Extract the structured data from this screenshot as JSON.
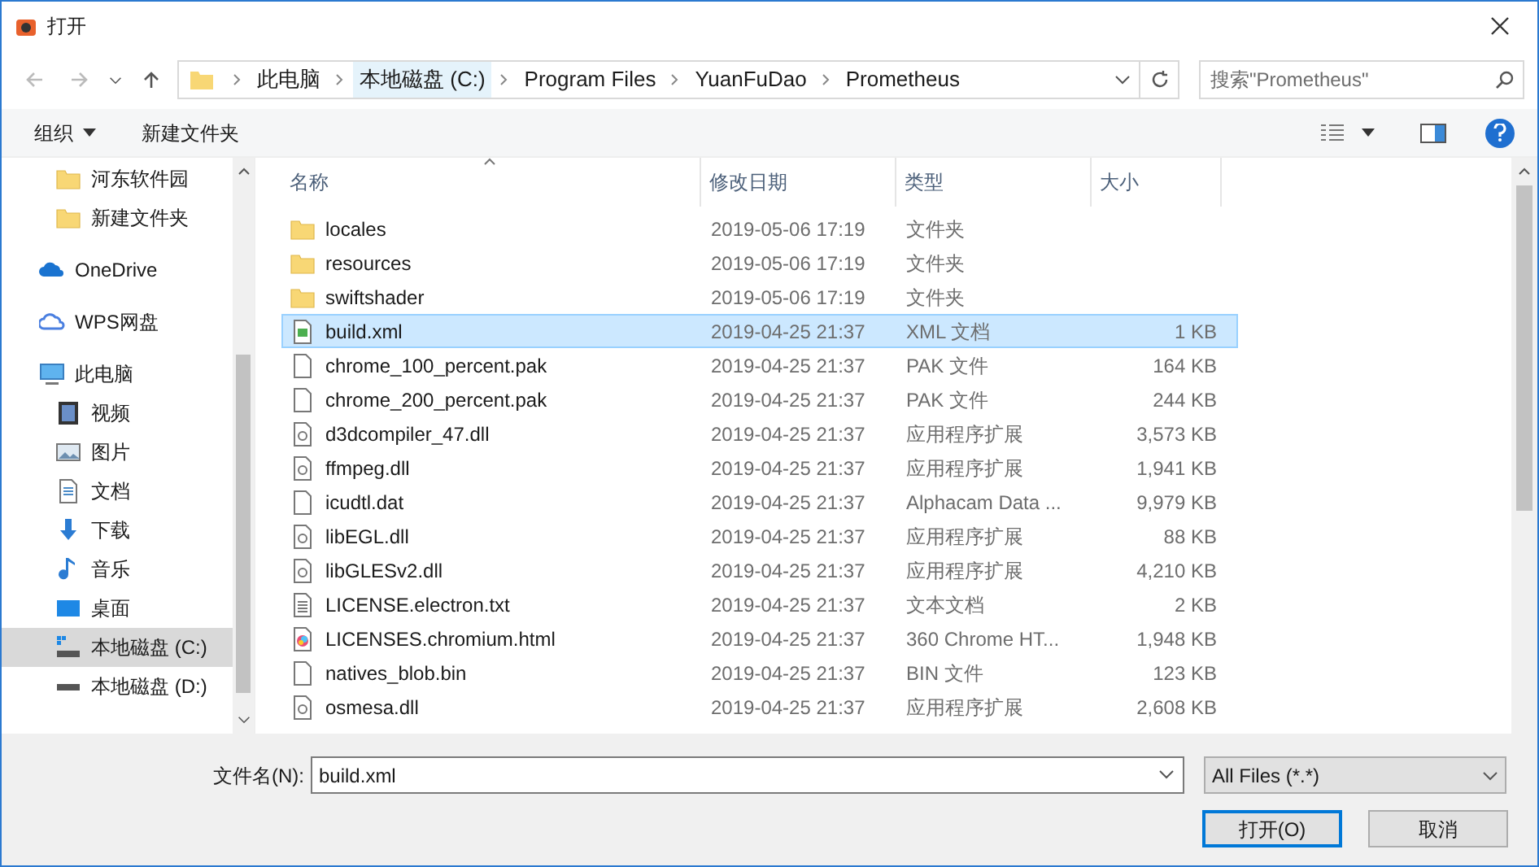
{
  "window": {
    "title": "打开"
  },
  "address": {
    "crumbs": [
      {
        "label": "此电脑",
        "selected": false
      },
      {
        "label": "本地磁盘 (C:)",
        "selected": true
      },
      {
        "label": "Program Files",
        "selected": false
      },
      {
        "label": "YuanFuDao",
        "selected": false
      },
      {
        "label": "Prometheus",
        "selected": false
      }
    ]
  },
  "search": {
    "placeholder": "搜索\"Prometheus\""
  },
  "toolbar": {
    "organize": "组织",
    "new_folder": "新建文件夹"
  },
  "sidebar": {
    "quick_access": [
      {
        "label": "河东软件园",
        "kind": "folder",
        "selected": false
      },
      {
        "label": "新建文件夹",
        "kind": "folder",
        "selected": false
      }
    ],
    "items": [
      {
        "label": "OneDrive",
        "kind": "cloud",
        "selected": false
      },
      {
        "label": "WPS网盘",
        "kind": "cloud-outline",
        "selected": false
      },
      {
        "label": "此电脑",
        "kind": "pc",
        "selected": false,
        "children": [
          {
            "label": "视频",
            "kind": "video",
            "selected": false
          },
          {
            "label": "图片",
            "kind": "picture",
            "selected": false
          },
          {
            "label": "文档",
            "kind": "doc",
            "selected": false
          },
          {
            "label": "下载",
            "kind": "download",
            "selected": false
          },
          {
            "label": "音乐",
            "kind": "music",
            "selected": false
          },
          {
            "label": "桌面",
            "kind": "desktop",
            "selected": false
          },
          {
            "label": "本地磁盘 (C:)",
            "kind": "drive-c",
            "selected": true
          },
          {
            "label": "本地磁盘 (D:)",
            "kind": "drive",
            "selected": false
          }
        ]
      }
    ]
  },
  "table": {
    "columns": [
      "名称",
      "修改日期",
      "类型",
      "大小"
    ],
    "rows": [
      {
        "name": "locales",
        "date": "2019-05-06 17:19",
        "type": "文件夹",
        "kind": "folder",
        "selected": false
      },
      {
        "name": "resources",
        "date": "2019-05-06 17:19",
        "type": "文件夹",
        "kind": "folder",
        "selected": false
      },
      {
        "name": "swiftshader",
        "date": "2019-05-06 17:19",
        "type": "文件夹",
        "kind": "folder",
        "selected": false
      },
      {
        "name": "build.xml",
        "date": "2019-04-25 21:37",
        "type": "XML 文档",
        "size": "1 KB",
        "kind": "xml",
        "selected": true
      },
      {
        "name": "chrome_100_percent.pak",
        "date": "2019-04-25 21:37",
        "type": "PAK 文件",
        "size": "164 KB",
        "kind": "file",
        "selected": false
      },
      {
        "name": "chrome_200_percent.pak",
        "date": "2019-04-25 21:37",
        "type": "PAK 文件",
        "size": "244 KB",
        "kind": "file",
        "selected": false
      },
      {
        "name": "d3dcompiler_47.dll",
        "date": "2019-04-25 21:37",
        "type": "应用程序扩展",
        "size": "3,573 KB",
        "kind": "dll",
        "selected": false
      },
      {
        "name": "ffmpeg.dll",
        "date": "2019-04-25 21:37",
        "type": "应用程序扩展",
        "size": "1,941 KB",
        "kind": "dll",
        "selected": false
      },
      {
        "name": "icudtl.dat",
        "date": "2019-04-25 21:37",
        "type": "Alphacam Data ...",
        "size": "9,979 KB",
        "kind": "file",
        "selected": false
      },
      {
        "name": "libEGL.dll",
        "date": "2019-04-25 21:37",
        "type": "应用程序扩展",
        "size": "88 KB",
        "kind": "dll",
        "selected": false
      },
      {
        "name": "libGLESv2.dll",
        "date": "2019-04-25 21:37",
        "type": "应用程序扩展",
        "size": "4,210 KB",
        "kind": "dll",
        "selected": false
      },
      {
        "name": "LICENSE.electron.txt",
        "date": "2019-04-25 21:37",
        "type": "文本文档",
        "size": "2 KB",
        "kind": "text",
        "selected": false
      },
      {
        "name": "LICENSES.chromium.html",
        "date": "2019-04-25 21:37",
        "type": "360 Chrome HT...",
        "size": "1,948 KB",
        "kind": "html",
        "selected": false
      },
      {
        "name": "natives_blob.bin",
        "date": "2019-04-25 21:37",
        "type": "BIN 文件",
        "size": "123 KB",
        "kind": "file",
        "selected": false
      },
      {
        "name": "osmesa.dll",
        "date": "2019-04-25 21:37",
        "type": "应用程序扩展",
        "size": "2,608 KB",
        "kind": "dll",
        "selected": false
      }
    ]
  },
  "footer": {
    "filename_label": "文件名(N):",
    "filename": "build.xml",
    "filter": "All Files (*.*)",
    "open": "打开(O)",
    "cancel": "取消"
  }
}
